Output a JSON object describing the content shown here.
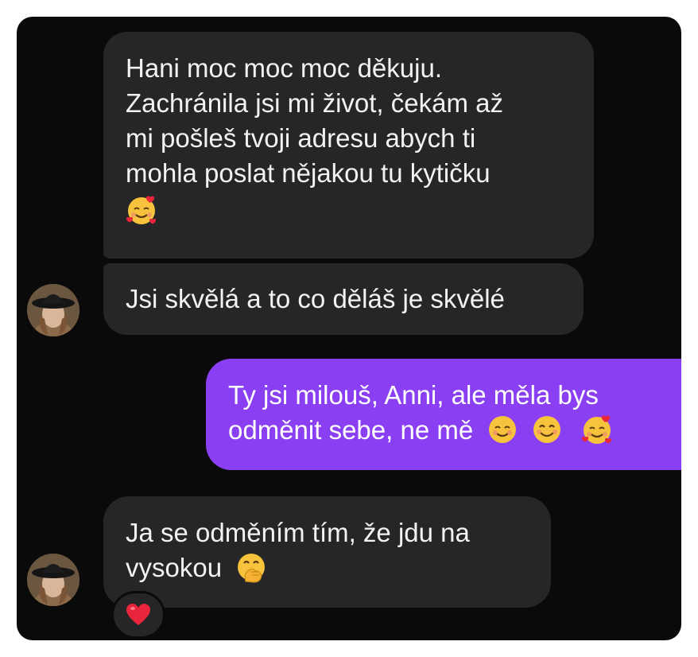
{
  "messages": [
    {
      "sender": "incoming",
      "lines": [
        "Hani moc moc moc děkuju.",
        "Zachránila jsi mi život, čekám až",
        "mi pošleš tvoji adresu abych ti",
        "mohla poslat nějakou tu kytičku"
      ],
      "emojis": [
        "smiling-face-with-hearts"
      ]
    },
    {
      "sender": "incoming",
      "text": "Jsi skvělá a to co děláš je skvělé"
    },
    {
      "sender": "outgoing",
      "lines": [
        "Ty jsi milouš, Anni, ale měla bys",
        "odměnit sebe, ne mě"
      ],
      "emojis": [
        "smiling-face",
        "smiling-face-with-smiling-eyes",
        "smiling-face-with-hearts"
      ]
    },
    {
      "sender": "incoming",
      "lines": [
        "Ja se odměním tím, že jdu na",
        "vysokou"
      ],
      "emojis": [
        "face-with-hand-over-mouth"
      ],
      "reaction": "red-heart"
    }
  ],
  "colors": {
    "background": "#0a0a0a",
    "incoming_bubble": "#262628",
    "outgoing_bubble": "#8a3ff2",
    "text": "#f2f2f2"
  }
}
